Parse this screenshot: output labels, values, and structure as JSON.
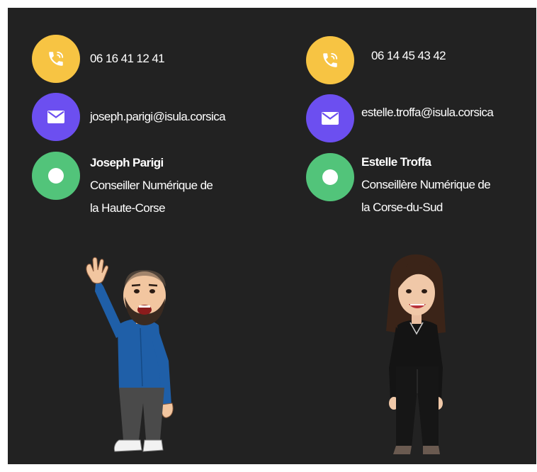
{
  "colors": {
    "panel_bg": "#222222",
    "phone_icon_bg": "#f7c443",
    "mail_icon_bg": "#6c4ff0",
    "status_icon_bg": "#52c47a"
  },
  "contacts": [
    {
      "phone": "06 16 41 12 41",
      "email": "joseph.parigi@isula.corsica",
      "name": "Joseph Parigi",
      "role_line1": "Conseiller Numérique de",
      "role_line2": "la Haute-Corse",
      "avatar": "bitmoji-man-waving"
    },
    {
      "phone": "06 14 45 43 42",
      "email": "estelle.troffa@isula.corsica",
      "name": "Estelle Troffa",
      "role_line1": "Conseillère Numérique de",
      "role_line2": "la Corse-du-Sud",
      "avatar": "bitmoji-woman-standing"
    }
  ]
}
